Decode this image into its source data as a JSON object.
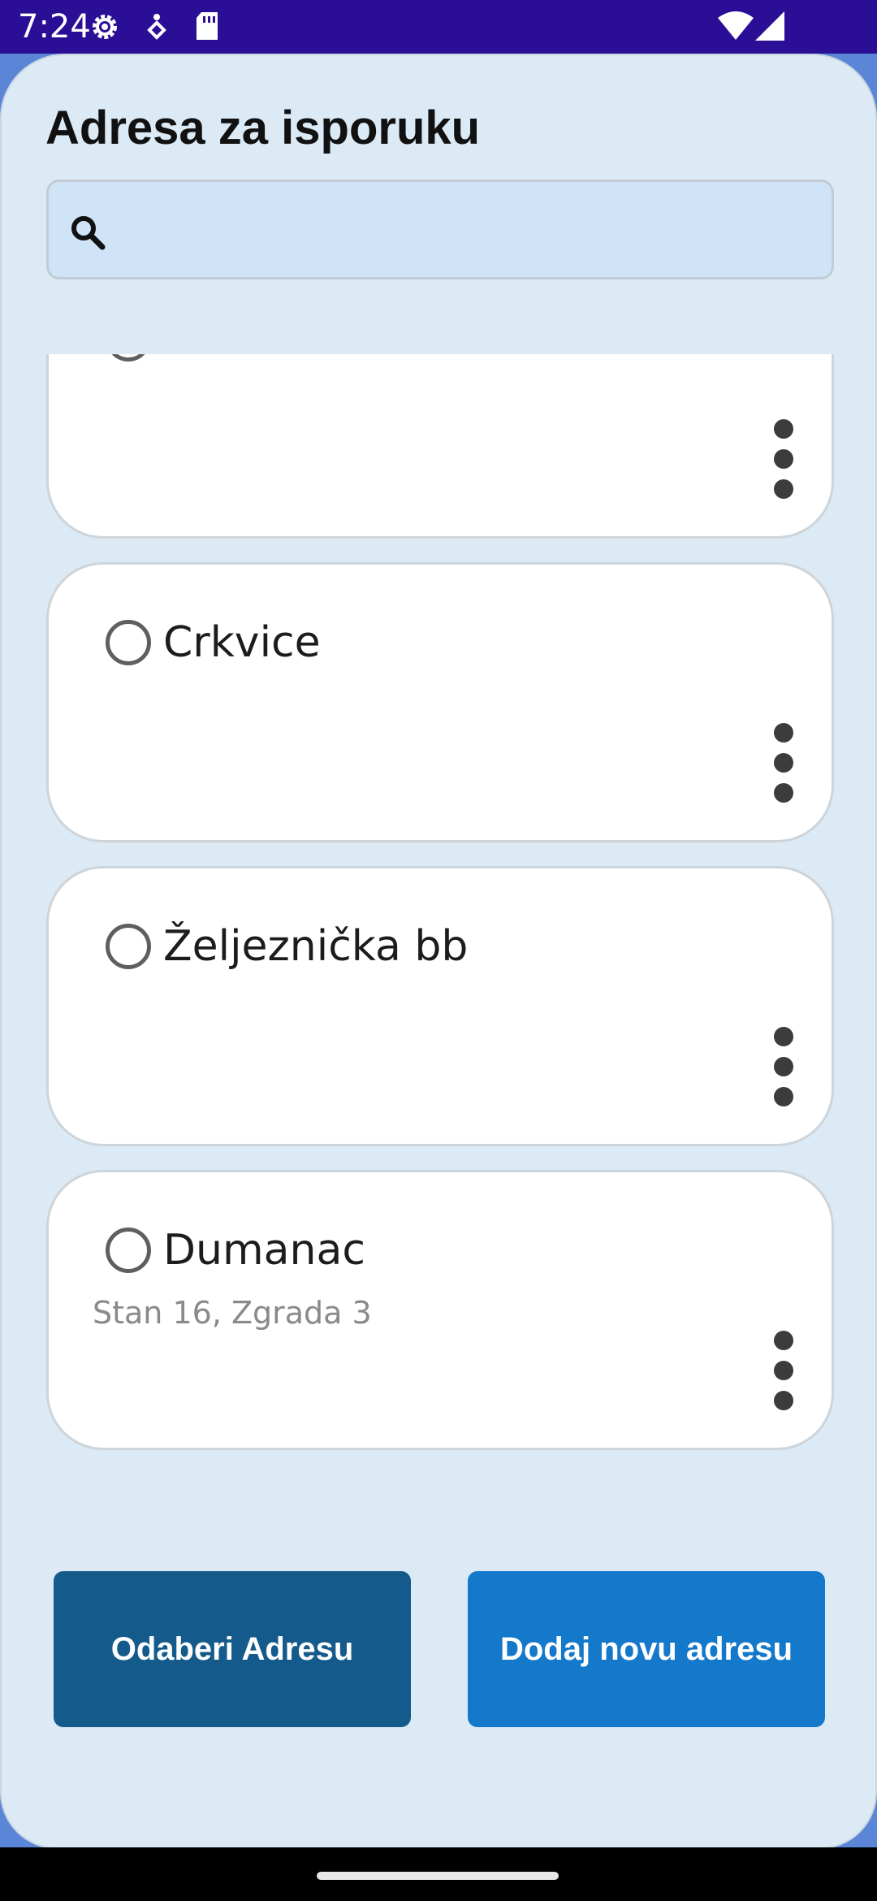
{
  "status_bar": {
    "time": "7:24",
    "icons": [
      "settings-gear-icon",
      "accessibility-icon",
      "sim-card-icon",
      "wifi-icon",
      "cellular-signal-icon"
    ]
  },
  "header": {
    "title": "Adresa za isporuku"
  },
  "search": {
    "icon": "search-icon",
    "value": "",
    "placeholder": ""
  },
  "addresses": [
    {
      "title": "",
      "subtitle": "",
      "selected": false
    },
    {
      "title": "Crkvice",
      "subtitle": "",
      "selected": false
    },
    {
      "title": "Željeznička bb",
      "subtitle": "",
      "selected": false
    },
    {
      "title": "Dumanac",
      "subtitle": "Stan 16, Zgrada 3",
      "selected": false
    }
  ],
  "actions": {
    "select_label": "Odaberi Adresu",
    "add_label": "Dodaj novu adresu"
  },
  "colors": {
    "status_bar": "#2a0f96",
    "sheet_background": "#dbeaf5",
    "search_background": "#cfe4f7",
    "select_button": "#145b8c",
    "add_button": "#1478cb"
  }
}
